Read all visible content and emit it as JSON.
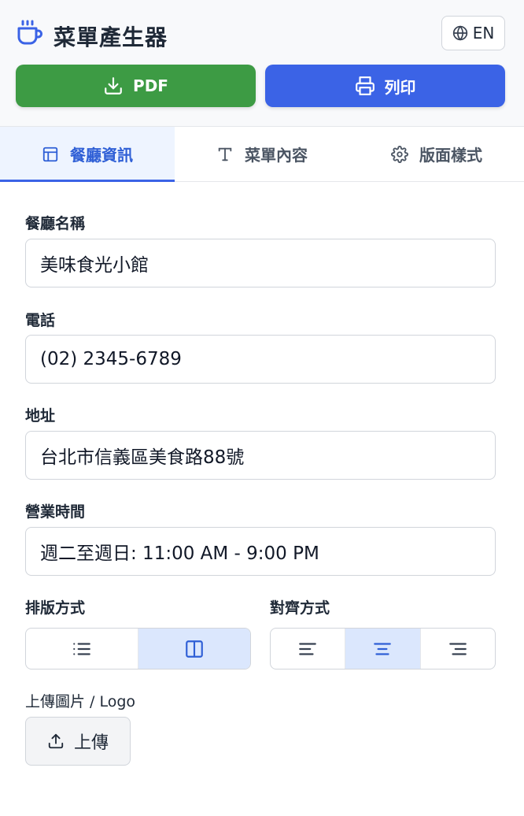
{
  "header": {
    "title": "菜單產生器",
    "logo_icon": "coffee-cup-icon",
    "lang_label": "EN",
    "pdf_label": "PDF",
    "print_label": "列印"
  },
  "tabs": [
    {
      "label": "餐廳資訊",
      "icon": "layout-icon",
      "active": true
    },
    {
      "label": "菜單內容",
      "icon": "text-icon",
      "active": false
    },
    {
      "label": "版面樣式",
      "icon": "gear-icon",
      "active": false
    }
  ],
  "form": {
    "name_label": "餐廳名稱",
    "name_value": "美味食光小館",
    "phone_label": "電話",
    "phone_value": "(02) 2345-6789",
    "address_label": "地址",
    "address_value": "台北市信義區美食路88號",
    "hours_label": "營業時間",
    "hours_value": "週二至週日: 11:00 AM - 9:00 PM",
    "layout_label": "排版方式",
    "layout_selected": "two-column",
    "align_label": "對齊方式",
    "align_selected": "center",
    "upload_label": "上傳圖片 / Logo",
    "upload_button": "上傳"
  },
  "colors": {
    "pdf_button": "#3d9b44",
    "print_button": "#3b63e6",
    "active_tab": "#2f5fd6",
    "selected_segment": "#dbe7fd"
  }
}
